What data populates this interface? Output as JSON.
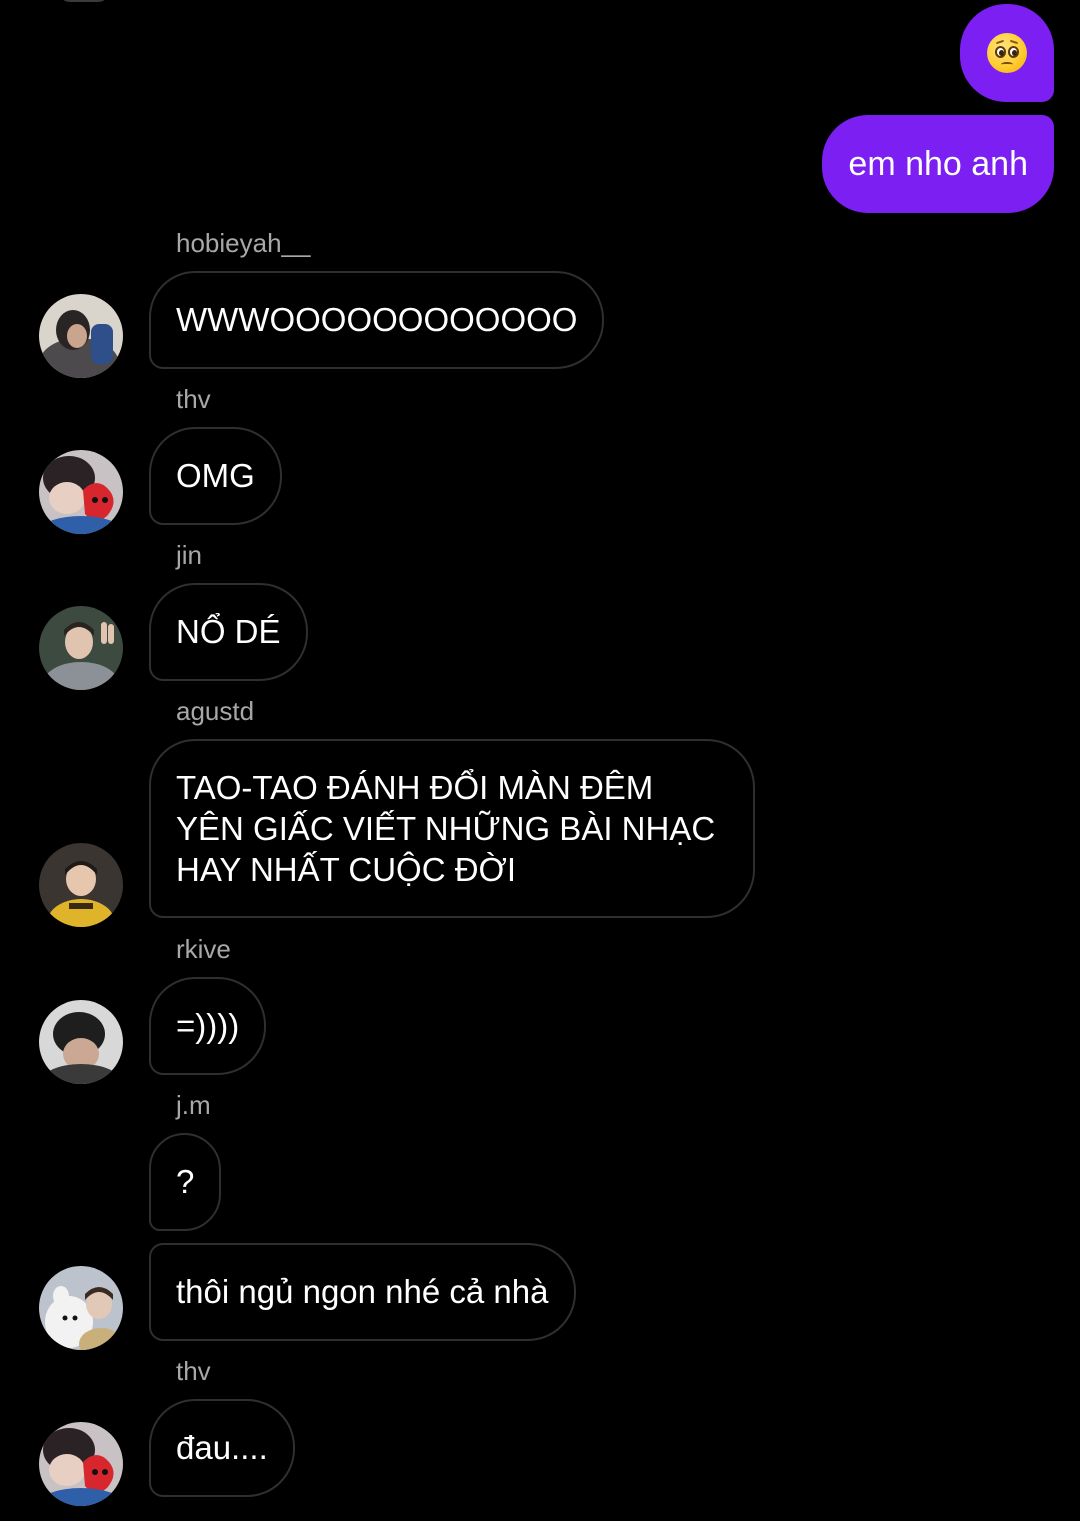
{
  "theme": {
    "background": "#000000",
    "sent_bubble": "#7b1ff2",
    "received_border": "#2f2f2f",
    "username_color": "#a8a8a8"
  },
  "sent": {
    "emoji_message": {
      "icon": "pleading-face-emoji"
    },
    "text_message": "em nho anh"
  },
  "messages": [
    {
      "user": "hobieyah__",
      "text": "WWWOOOOOOOOOOOO"
    },
    {
      "user": "thv",
      "text": "OMG"
    },
    {
      "user": "jin",
      "text": "NỔ DÉ"
    },
    {
      "user": "agustd",
      "text": "TAO-TAO ĐÁNH ĐỔI MÀN ĐÊM YÊN GIẤC VIẾT NHỮNG BÀI NHẠC HAY NHẤT CUỘC ĐỜI"
    },
    {
      "user": "rkive",
      "text": "=))))"
    },
    {
      "user": "j.m",
      "text": "?"
    },
    {
      "user": "j.m",
      "text": "thôi ngủ ngon nhé cả nhà"
    },
    {
      "user": "thv",
      "text": "đau...."
    }
  ]
}
